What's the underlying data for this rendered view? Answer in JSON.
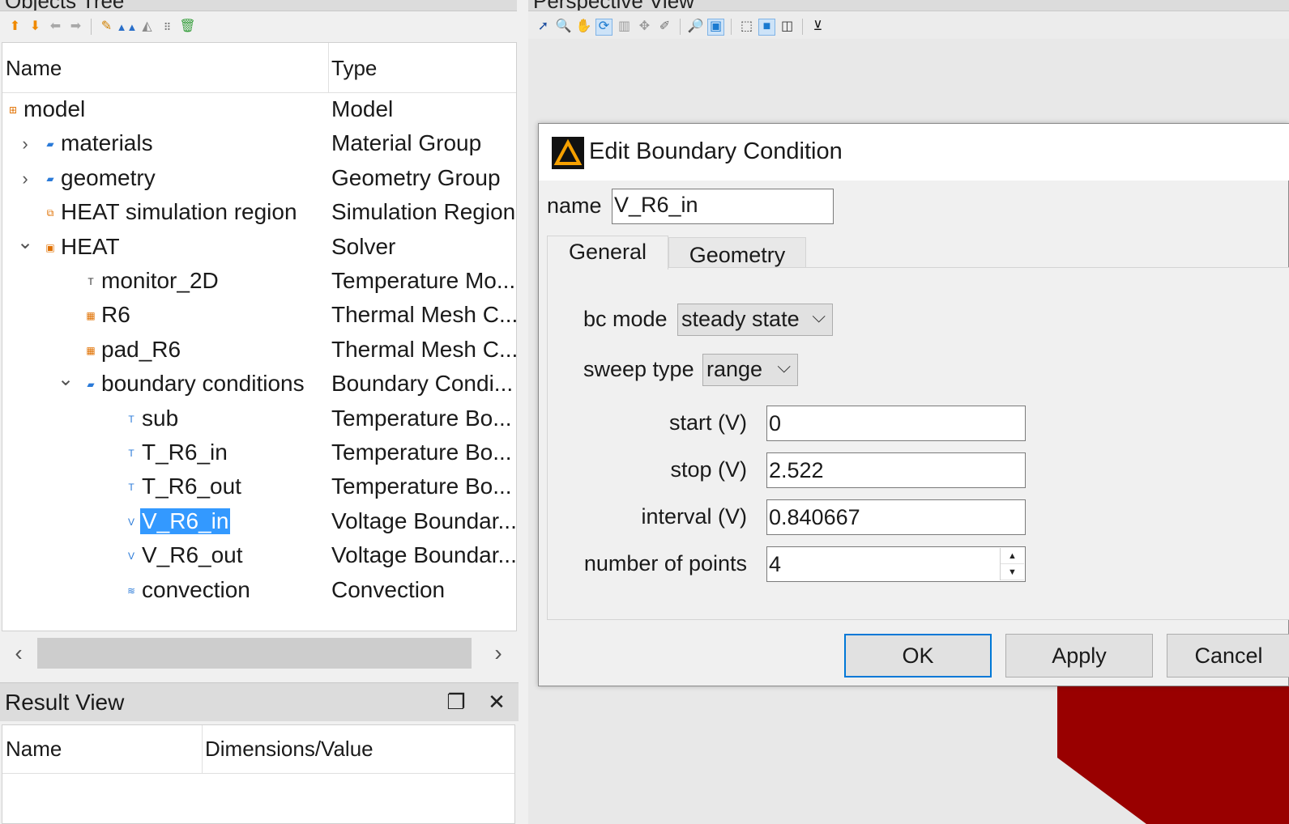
{
  "objects_tree": {
    "title": "Objects Tree",
    "toolbar_icons": [
      "arrow-up-icon",
      "arrow-down-icon",
      "arrow-left-icon",
      "arrow-right-icon",
      "edit-icon",
      "mountains-icon",
      "triangle-icon",
      "grid-icon",
      "trash-icon"
    ],
    "columns": {
      "name": "Name",
      "type": "Type"
    },
    "rows": [
      {
        "name": "model",
        "type": "Model",
        "icon": "model-icon",
        "expander": ""
      },
      {
        "name": "materials",
        "type": "Material Group",
        "icon": "folder-icon",
        "expander": "›"
      },
      {
        "name": "geometry",
        "type": "Geometry Group",
        "icon": "folder-icon",
        "expander": "›"
      },
      {
        "name": "HEAT simulation region",
        "type": "Simulation Region",
        "icon": "region-icon",
        "expander": ""
      },
      {
        "name": "HEAT",
        "type": "Solver",
        "icon": "solver-icon",
        "expander": "⌄"
      },
      {
        "name": "monitor_2D",
        "type": "Temperature Mo...",
        "icon": "monitor-icon",
        "expander": ""
      },
      {
        "name": "R6",
        "type": "Thermal Mesh C...",
        "icon": "mesh-icon",
        "expander": ""
      },
      {
        "name": "pad_R6",
        "type": "Thermal Mesh C...",
        "icon": "mesh-icon",
        "expander": ""
      },
      {
        "name": "boundary conditions",
        "type": "Boundary Condi...",
        "icon": "folder-icon",
        "expander": "⌄"
      },
      {
        "name": "sub",
        "type": "Temperature Bo...",
        "icon": "temperature-bc-icon",
        "expander": ""
      },
      {
        "name": "T_R6_in",
        "type": "Temperature Bo...",
        "icon": "temperature-bc-icon",
        "expander": ""
      },
      {
        "name": "T_R6_out",
        "type": "Temperature Bo...",
        "icon": "temperature-bc-icon",
        "expander": ""
      },
      {
        "name": "V_R6_in",
        "type": "Voltage Boundar...",
        "icon": "voltage-bc-icon",
        "expander": "",
        "selected": true
      },
      {
        "name": "V_R6_out",
        "type": "Voltage Boundar...",
        "icon": "voltage-bc-icon",
        "expander": ""
      },
      {
        "name": "convection",
        "type": "Convection",
        "icon": "convection-icon",
        "expander": ""
      }
    ]
  },
  "result_view": {
    "title": "Result View",
    "columns": {
      "name": "Name",
      "value": "Dimensions/Value"
    }
  },
  "perspective_view": {
    "title": "Perspective View",
    "toolbar_icons": [
      "pointer-icon",
      "zoom-icon",
      "pan-hand-icon",
      "rotate-icon",
      "ruler-icon",
      "move-icon",
      "draw-icon",
      "zoom-extent-icon",
      "select-box-icon",
      "wireframe-cube-icon",
      "solid-cube-icon",
      "cube-outline-icon",
      "axis-icon"
    ]
  },
  "dialog": {
    "title": "Edit Boundary Condition",
    "name_label": "name",
    "name_value": "V_R6_in",
    "tabs": [
      "General",
      "Geometry"
    ],
    "bc_mode_label": "bc mode",
    "bc_mode_value": "steady state",
    "sweep_type_label": "sweep type",
    "sweep_type_value": "range",
    "start_label": "start (V)",
    "start_value": "0",
    "stop_label": "stop (V)",
    "stop_value": "2.522",
    "interval_label": "interval (V)",
    "interval_value": "0.840667",
    "points_label": "number of points",
    "points_value": "4",
    "ok_label": "OK",
    "apply_label": "Apply",
    "cancel_label": "Cancel"
  },
  "colors": {
    "selection": "#3399ff",
    "accent_orange": "#f5a000",
    "model_shape_red": "#990000",
    "default_button_border": "#0078d7"
  }
}
